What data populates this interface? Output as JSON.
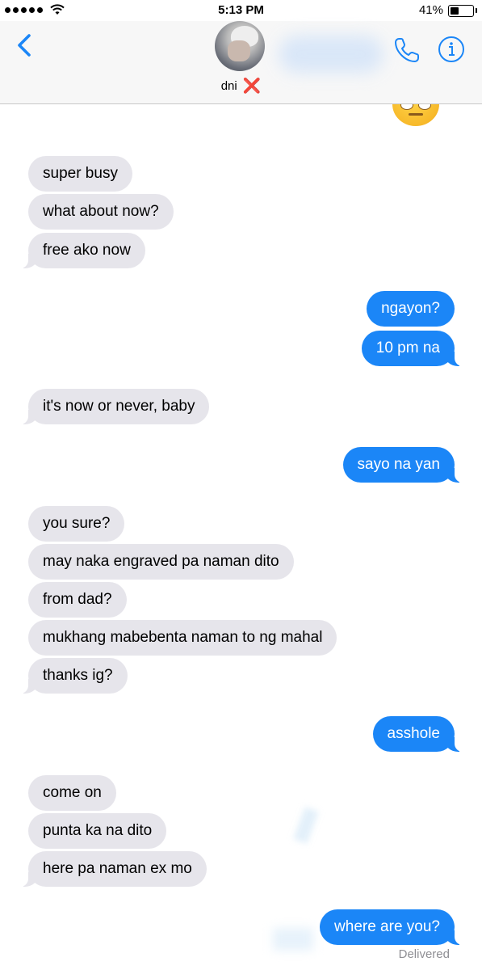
{
  "status_bar": {
    "time": "5:13 PM",
    "battery_percent": "41%",
    "battery_level": 0.41,
    "signal_dots": 5,
    "icons": [
      "signal-dots-icon",
      "wifi-icon",
      "battery-icon"
    ]
  },
  "header": {
    "contact_name": "dni",
    "name_emoji": "❌",
    "icons": [
      "back-chevron-icon",
      "phone-icon",
      "info-icon"
    ],
    "accent_color": "#1b86f7"
  },
  "messages": [
    {
      "from": "them",
      "text": "super busy"
    },
    {
      "from": "them",
      "text": "what about now?"
    },
    {
      "from": "them",
      "text": "free ako now"
    },
    {
      "from": "me",
      "text": "ngayon?"
    },
    {
      "from": "me",
      "text": "10 pm na"
    },
    {
      "from": "them",
      "text": "it's now or never, baby"
    },
    {
      "from": "me",
      "text": "sayo na yan"
    },
    {
      "from": "them",
      "text": "you sure?"
    },
    {
      "from": "them",
      "text": "may naka engraved pa naman dito"
    },
    {
      "from": "them",
      "text": "from dad?"
    },
    {
      "from": "them",
      "text": "mukhang mabebenta naman to ng mahal"
    },
    {
      "from": "them",
      "text": "thanks ig?"
    },
    {
      "from": "me",
      "text": "asshole"
    },
    {
      "from": "them",
      "text": "come on"
    },
    {
      "from": "them",
      "text": "punta ka na dito"
    },
    {
      "from": "them",
      "text": "here pa naman ex mo"
    },
    {
      "from": "me",
      "text": "where are you?"
    }
  ],
  "delivery_status": "Delivered",
  "colors": {
    "incoming_bubble": "#e6e5eb",
    "outgoing_bubble": "#1b86f7",
    "status_text": "#8e8e93"
  }
}
